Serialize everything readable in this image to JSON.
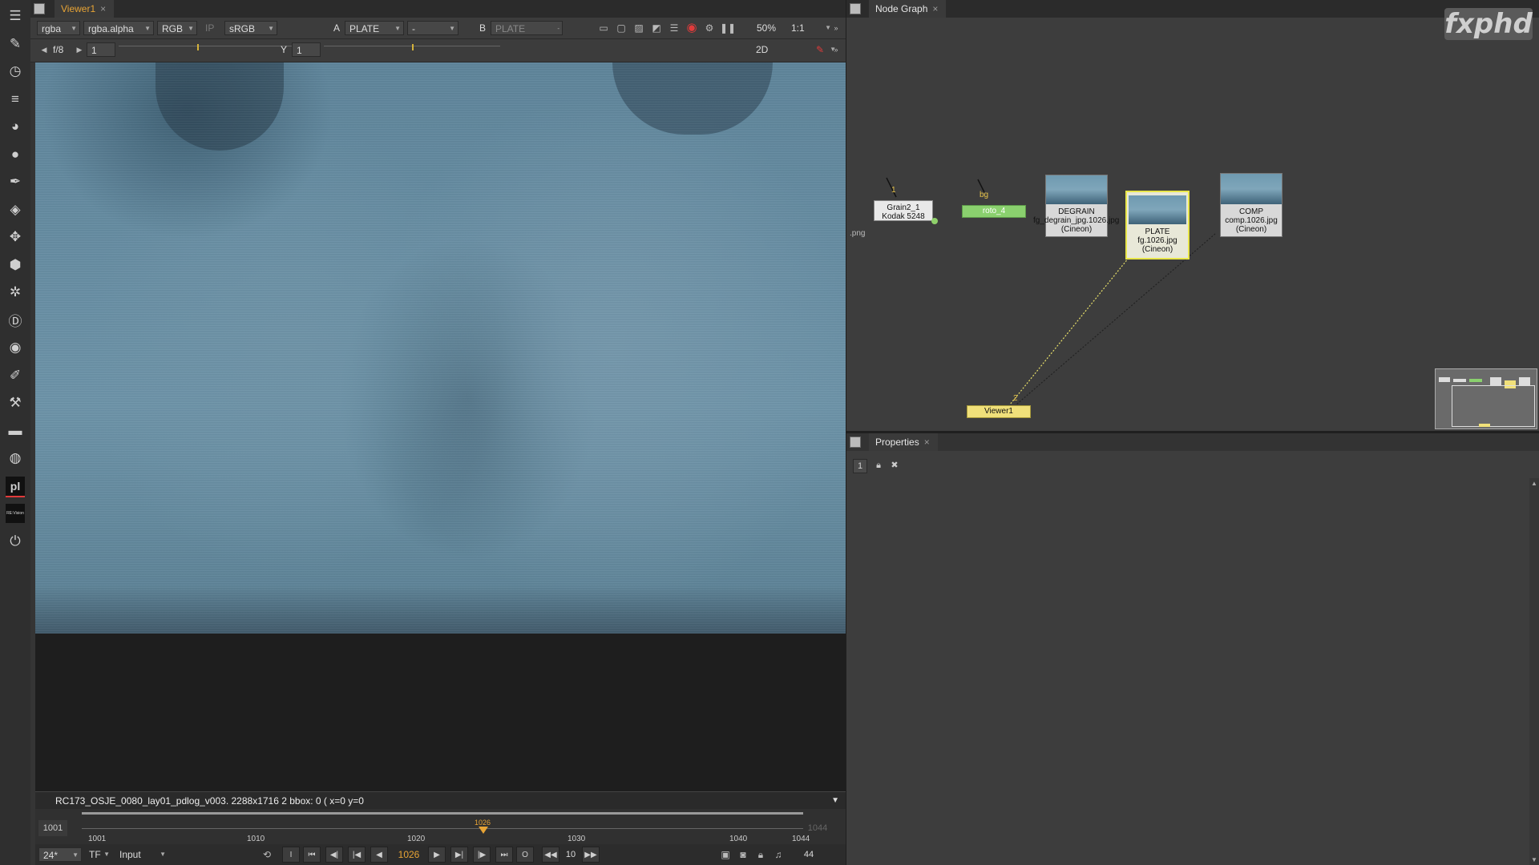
{
  "toolbar": {
    "tools": [
      {
        "name": "viewer-menu-icon",
        "glyph": "☰"
      },
      {
        "name": "draw-tool-icon",
        "glyph": "✎"
      },
      {
        "name": "time-tool-icon",
        "glyph": "◷"
      },
      {
        "name": "channel-tool-icon",
        "glyph": "≡"
      },
      {
        "name": "color-tool-icon",
        "glyph": "◕"
      },
      {
        "name": "filter-tool-icon",
        "glyph": "●"
      },
      {
        "name": "keyer-tool-icon",
        "glyph": "✒"
      },
      {
        "name": "merge-tool-icon",
        "glyph": "◈"
      },
      {
        "name": "transform-tool-icon",
        "glyph": "✥"
      },
      {
        "name": "3d-tool-icon",
        "glyph": "⬢"
      },
      {
        "name": "particles-tool-icon",
        "glyph": "✲"
      },
      {
        "name": "deep-tool-icon",
        "glyph": "Ⓓ"
      },
      {
        "name": "views-tool-icon",
        "glyph": "◉"
      },
      {
        "name": "metadata-tool-icon",
        "glyph": "✐"
      },
      {
        "name": "toolsets-tool-icon",
        "glyph": "⚒"
      },
      {
        "name": "other-tool-icon",
        "glyph": "▬"
      },
      {
        "name": "furnace-tool-icon",
        "glyph": "◍"
      },
      {
        "name": "pl-plugin-icon",
        "glyph": "pl"
      },
      {
        "name": "revision-plugin-icon",
        "glyph": "RE:Vision"
      },
      {
        "name": "power-plugin-icon",
        "glyph": "⏻"
      }
    ]
  },
  "viewer": {
    "tab_title": "Viewer1",
    "close_glyph": "×",
    "channels": "rgba",
    "alpha_channel": "rgba.alpha",
    "display_channel": "RGB",
    "ip_label": "IP",
    "lut": "sRGB",
    "a_label": "A",
    "a_input": "PLATE",
    "wipe_mode": "-",
    "b_label": "B",
    "b_input": "PLATE",
    "zoom": "50%",
    "ratio": "1:1",
    "fstop": "f/8",
    "gain_value": "1",
    "gamma_label": "Y",
    "gamma_value": "1",
    "view_mode": "2D",
    "gain_ticks": [
      "0.03125",
      "0.1",
      "",
      "1",
      "",
      "16",
      "64"
    ],
    "gamma_ticks": [
      "0.2",
      "0.5",
      "1",
      "2",
      "3",
      "4"
    ],
    "info_text": "RC173_OSJE_0080_lay01_pdlog_v003. 2288x1716 2  bbox: 0 (  x=0 y=0"
  },
  "timeline": {
    "start_frame": "1001",
    "current_frame": "1026",
    "ticks": [
      "1001",
      "1010",
      "1020",
      "1030",
      "1040",
      "1044"
    ],
    "end_frame_ghost": "1044",
    "fps": "24*",
    "tf": "TF",
    "range_mode": "Input",
    "transport_frame": "1026",
    "step": "10",
    "end_frame": "44"
  },
  "node_graph": {
    "tab_title": "Node Graph",
    "close_glyph": "×",
    "logo": "fxphd",
    "nodes": {
      "grain": {
        "line1": "Grain2_1",
        "line2": "Kodak 5248",
        "input_num": "1"
      },
      "roto": {
        "label": "roto_4",
        "input_label": "bg"
      },
      "degrain": {
        "line1": "DEGRAIN",
        "line2": "fg_degrain_jpg.1026.jpg",
        "line3": "(Cineon)"
      },
      "plate": {
        "line1": "PLATE",
        "line2": "fg.1026.jpg",
        "line3": "(Cineon)"
      },
      "comp": {
        "line1": "COMP",
        "line2": "comp.1026.jpg",
        "line3": "(Cineon)"
      },
      "viewer": {
        "label": "Viewer1",
        "input_num": "2"
      }
    },
    "stray_text": ".png"
  },
  "properties": {
    "tab_title": "Properties",
    "close_glyph": "×",
    "max_panels": "1",
    "clear_label": "✖"
  }
}
